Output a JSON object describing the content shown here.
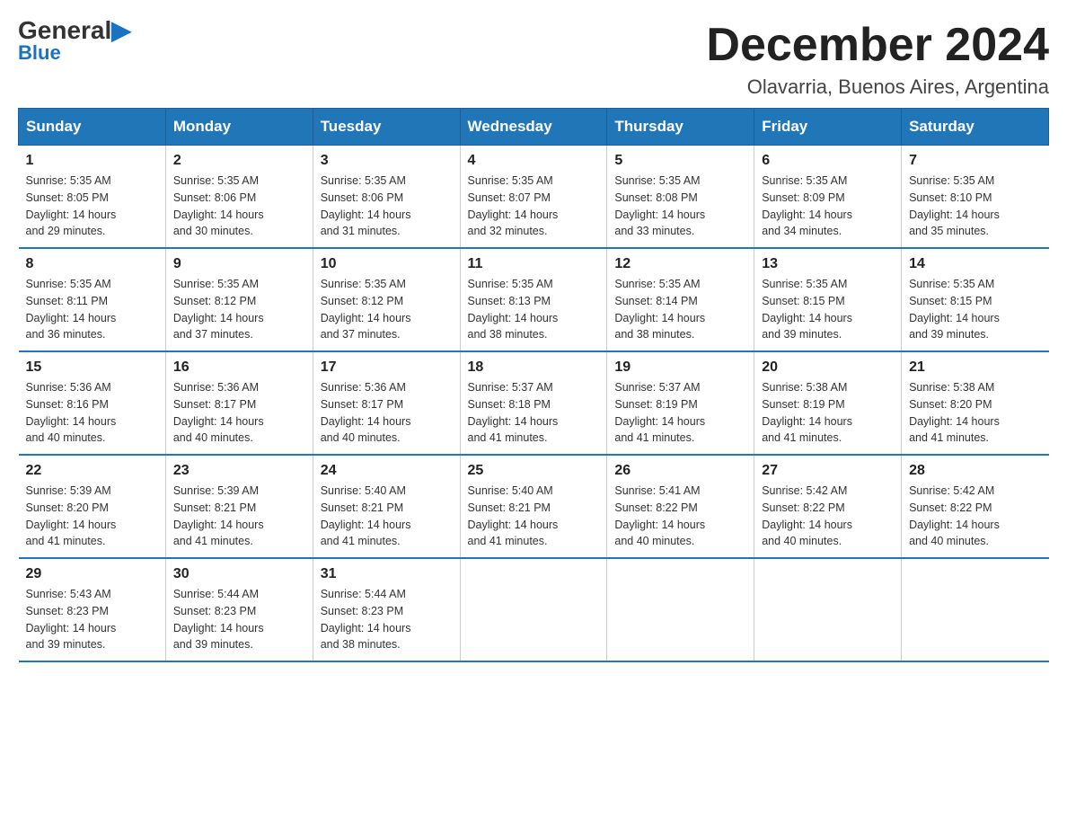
{
  "logo": {
    "general": "General",
    "arrow": "▶",
    "blue": "Blue"
  },
  "title": "December 2024",
  "location": "Olavarria, Buenos Aires, Argentina",
  "weekdays": [
    "Sunday",
    "Monday",
    "Tuesday",
    "Wednesday",
    "Thursday",
    "Friday",
    "Saturday"
  ],
  "weeks": [
    [
      {
        "day": "1",
        "sunrise": "5:35 AM",
        "sunset": "8:05 PM",
        "daylight": "14 hours and 29 minutes."
      },
      {
        "day": "2",
        "sunrise": "5:35 AM",
        "sunset": "8:06 PM",
        "daylight": "14 hours and 30 minutes."
      },
      {
        "day": "3",
        "sunrise": "5:35 AM",
        "sunset": "8:06 PM",
        "daylight": "14 hours and 31 minutes."
      },
      {
        "day": "4",
        "sunrise": "5:35 AM",
        "sunset": "8:07 PM",
        "daylight": "14 hours and 32 minutes."
      },
      {
        "day": "5",
        "sunrise": "5:35 AM",
        "sunset": "8:08 PM",
        "daylight": "14 hours and 33 minutes."
      },
      {
        "day": "6",
        "sunrise": "5:35 AM",
        "sunset": "8:09 PM",
        "daylight": "14 hours and 34 minutes."
      },
      {
        "day": "7",
        "sunrise": "5:35 AM",
        "sunset": "8:10 PM",
        "daylight": "14 hours and 35 minutes."
      }
    ],
    [
      {
        "day": "8",
        "sunrise": "5:35 AM",
        "sunset": "8:11 PM",
        "daylight": "14 hours and 36 minutes."
      },
      {
        "day": "9",
        "sunrise": "5:35 AM",
        "sunset": "8:12 PM",
        "daylight": "14 hours and 37 minutes."
      },
      {
        "day": "10",
        "sunrise": "5:35 AM",
        "sunset": "8:12 PM",
        "daylight": "14 hours and 37 minutes."
      },
      {
        "day": "11",
        "sunrise": "5:35 AM",
        "sunset": "8:13 PM",
        "daylight": "14 hours and 38 minutes."
      },
      {
        "day": "12",
        "sunrise": "5:35 AM",
        "sunset": "8:14 PM",
        "daylight": "14 hours and 38 minutes."
      },
      {
        "day": "13",
        "sunrise": "5:35 AM",
        "sunset": "8:15 PM",
        "daylight": "14 hours and 39 minutes."
      },
      {
        "day": "14",
        "sunrise": "5:35 AM",
        "sunset": "8:15 PM",
        "daylight": "14 hours and 39 minutes."
      }
    ],
    [
      {
        "day": "15",
        "sunrise": "5:36 AM",
        "sunset": "8:16 PM",
        "daylight": "14 hours and 40 minutes."
      },
      {
        "day": "16",
        "sunrise": "5:36 AM",
        "sunset": "8:17 PM",
        "daylight": "14 hours and 40 minutes."
      },
      {
        "day": "17",
        "sunrise": "5:36 AM",
        "sunset": "8:17 PM",
        "daylight": "14 hours and 40 minutes."
      },
      {
        "day": "18",
        "sunrise": "5:37 AM",
        "sunset": "8:18 PM",
        "daylight": "14 hours and 41 minutes."
      },
      {
        "day": "19",
        "sunrise": "5:37 AM",
        "sunset": "8:19 PM",
        "daylight": "14 hours and 41 minutes."
      },
      {
        "day": "20",
        "sunrise": "5:38 AM",
        "sunset": "8:19 PM",
        "daylight": "14 hours and 41 minutes."
      },
      {
        "day": "21",
        "sunrise": "5:38 AM",
        "sunset": "8:20 PM",
        "daylight": "14 hours and 41 minutes."
      }
    ],
    [
      {
        "day": "22",
        "sunrise": "5:39 AM",
        "sunset": "8:20 PM",
        "daylight": "14 hours and 41 minutes."
      },
      {
        "day": "23",
        "sunrise": "5:39 AM",
        "sunset": "8:21 PM",
        "daylight": "14 hours and 41 minutes."
      },
      {
        "day": "24",
        "sunrise": "5:40 AM",
        "sunset": "8:21 PM",
        "daylight": "14 hours and 41 minutes."
      },
      {
        "day": "25",
        "sunrise": "5:40 AM",
        "sunset": "8:21 PM",
        "daylight": "14 hours and 41 minutes."
      },
      {
        "day": "26",
        "sunrise": "5:41 AM",
        "sunset": "8:22 PM",
        "daylight": "14 hours and 40 minutes."
      },
      {
        "day": "27",
        "sunrise": "5:42 AM",
        "sunset": "8:22 PM",
        "daylight": "14 hours and 40 minutes."
      },
      {
        "day": "28",
        "sunrise": "5:42 AM",
        "sunset": "8:22 PM",
        "daylight": "14 hours and 40 minutes."
      }
    ],
    [
      {
        "day": "29",
        "sunrise": "5:43 AM",
        "sunset": "8:23 PM",
        "daylight": "14 hours and 39 minutes."
      },
      {
        "day": "30",
        "sunrise": "5:44 AM",
        "sunset": "8:23 PM",
        "daylight": "14 hours and 39 minutes."
      },
      {
        "day": "31",
        "sunrise": "5:44 AM",
        "sunset": "8:23 PM",
        "daylight": "14 hours and 38 minutes."
      },
      null,
      null,
      null,
      null
    ]
  ],
  "labels": {
    "sunrise": "Sunrise:",
    "sunset": "Sunset:",
    "daylight": "Daylight:"
  }
}
